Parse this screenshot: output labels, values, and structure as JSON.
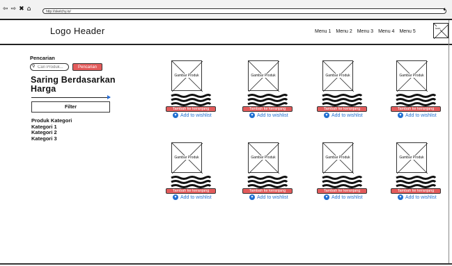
{
  "browser": {
    "url": "http://sketchy.io/",
    "nav": [
      "⇦",
      "⇨",
      "✖",
      "⌂"
    ]
  },
  "header": {
    "logo": "Logo Header",
    "menu": [
      "Menu 1",
      "Menu 2",
      "Menu 3",
      "Menu 4",
      "Menu 5"
    ],
    "icon_label": "icon"
  },
  "sidebar": {
    "search_label": "Pencarian",
    "search_placeholder": "Cari Produk...",
    "search_button": "Pencarian",
    "filter_title": "Saring Berdasarkan Harga",
    "filter_button": "Filter",
    "categories": [
      "Produk Kategori",
      "Kategori 1",
      "Kategori 2",
      "Kategori 3"
    ]
  },
  "products": [
    {
      "image": "Gambar Produk",
      "cart": "Tambah ke keranjang",
      "wishlist": "Add to wishlist"
    },
    {
      "image": "Gambar Produk",
      "cart": "Tambah ke keranjang",
      "wishlist": "Add to wishlist"
    },
    {
      "image": "Gambar Produk",
      "cart": "Tambah ke keranjang",
      "wishlist": "Add to wishlist"
    },
    {
      "image": "Gambar Produk",
      "cart": "Tambah ke keranjang",
      "wishlist": "Add to wishlist"
    },
    {
      "image": "Gambar Produk",
      "cart": "Tambah ke keranjang",
      "wishlist": "Add to wishlist"
    },
    {
      "image": "Gambar Produk",
      "cart": "Tambah ke keranjang",
      "wishlist": "Add to wishlist"
    },
    {
      "image": "Gambar Produk",
      "cart": "Tambah ke keranjang",
      "wishlist": "Add to wishlist"
    },
    {
      "image": "Gambar Produk",
      "cart": "Tambah ke keranjang",
      "wishlist": "Add to wishlist"
    }
  ],
  "colors": {
    "accent_red": "#e35b5b",
    "link_blue": "#1f6fd1",
    "border": "#333333"
  }
}
